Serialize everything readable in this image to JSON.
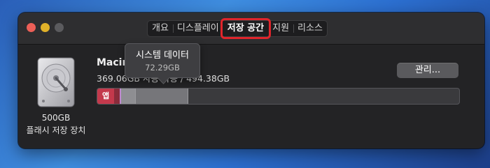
{
  "tabs": [
    "개요",
    "디스플레이",
    "저장 공간",
    "지원",
    "리소스"
  ],
  "active_tab_index": 2,
  "disk": {
    "size": "500GB",
    "type": "플래시 저장 장치",
    "icon": "hard-drive-icon"
  },
  "volume": {
    "name": "Macin",
    "usage": "369.06GB 사용 가능 / 494.38GB"
  },
  "manage_button": "관리...",
  "storage_bar": {
    "apps_label": "앱",
    "colors": {
      "apps": "#c4394c",
      "system": "#76767a"
    }
  },
  "tooltip": {
    "title": "시스템 데이터",
    "value": "72.29GB"
  },
  "colors": {
    "highlight": "#e0252b",
    "window_bg": "#232325"
  }
}
